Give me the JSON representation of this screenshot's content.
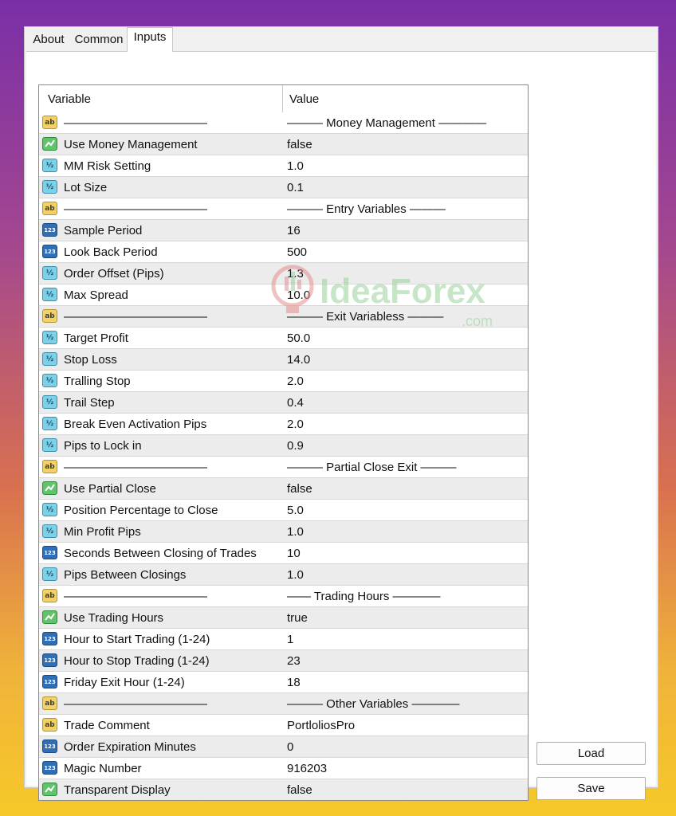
{
  "tabs": [
    "About",
    "Common",
    "Inputs"
  ],
  "active_tab": "Inputs",
  "table": {
    "headers": [
      "Variable",
      "Value"
    ],
    "rows": [
      {
        "type": "string",
        "icon": "string-ab-icon",
        "name": "————————————",
        "value": "——— Money Management ————"
      },
      {
        "type": "bool",
        "icon": "boolean-icon",
        "name": "Use Money Management",
        "value": "false"
      },
      {
        "type": "double",
        "icon": "double-icon",
        "name": "MM Risk Setting",
        "value": "1.0"
      },
      {
        "type": "double",
        "icon": "double-icon",
        "name": "Lot Size",
        "value": "0.1"
      },
      {
        "type": "string",
        "icon": "string-ab-icon",
        "name": "————————————",
        "value": "——— Entry Variables ———"
      },
      {
        "type": "int",
        "icon": "integer-icon",
        "name": "Sample Period",
        "value": "16"
      },
      {
        "type": "int",
        "icon": "integer-icon",
        "name": "Look Back Period",
        "value": "500"
      },
      {
        "type": "double",
        "icon": "double-icon",
        "name": "Order Offset (Pips)",
        "value": "1.3"
      },
      {
        "type": "double",
        "icon": "double-icon",
        "name": "Max Spread",
        "value": "10.0"
      },
      {
        "type": "string",
        "icon": "string-ab-icon",
        "name": "————————————",
        "value": "——— Exit Variabless ———"
      },
      {
        "type": "double",
        "icon": "double-icon",
        "name": "Target Profit",
        "value": "50.0"
      },
      {
        "type": "double",
        "icon": "double-icon",
        "name": "Stop Loss",
        "value": "14.0"
      },
      {
        "type": "double",
        "icon": "double-icon",
        "name": "Tralling Stop",
        "value": "2.0"
      },
      {
        "type": "double",
        "icon": "double-icon",
        "name": "Trail Step",
        "value": "0.4"
      },
      {
        "type": "double",
        "icon": "double-icon",
        "name": "Break Even Activation Pips",
        "value": "2.0"
      },
      {
        "type": "double",
        "icon": "double-icon",
        "name": "Pips to Lock in",
        "value": "0.9"
      },
      {
        "type": "string",
        "icon": "string-ab-icon",
        "name": "————————————",
        "value": "——— Partial Close Exit ———"
      },
      {
        "type": "bool",
        "icon": "boolean-icon",
        "name": "Use Partial Close",
        "value": "false"
      },
      {
        "type": "double",
        "icon": "double-icon",
        "name": "Position Percentage to Close",
        "value": "5.0"
      },
      {
        "type": "double",
        "icon": "double-icon",
        "name": "Min Profit Pips",
        "value": "1.0"
      },
      {
        "type": "int",
        "icon": "integer-icon",
        "name": "Seconds Between Closing of Trades",
        "value": "10"
      },
      {
        "type": "double",
        "icon": "double-icon",
        "name": "Pips Between Closings",
        "value": "1.0"
      },
      {
        "type": "string",
        "icon": "string-ab-icon",
        "name": "————————————",
        "value": "—— Trading Hours ————"
      },
      {
        "type": "bool",
        "icon": "boolean-icon",
        "name": "Use Trading Hours",
        "value": "true"
      },
      {
        "type": "int",
        "icon": "integer-icon",
        "name": "Hour to Start Trading (1-24)",
        "value": "1"
      },
      {
        "type": "int",
        "icon": "integer-icon",
        "name": "Hour to Stop Trading (1-24)",
        "value": "23"
      },
      {
        "type": "int",
        "icon": "integer-icon",
        "name": "Friday Exit Hour (1-24)",
        "value": "18"
      },
      {
        "type": "string",
        "icon": "string-ab-icon",
        "name": "————————————",
        "value": "——— Other Variables ————"
      },
      {
        "type": "string",
        "icon": "string-ab-icon",
        "name": "Trade Comment",
        "value": "PortloliosPro"
      },
      {
        "type": "int",
        "icon": "integer-icon",
        "name": "Order Expiration Minutes",
        "value": "0"
      },
      {
        "type": "int",
        "icon": "integer-icon",
        "name": "Magic Number",
        "value": "916203"
      },
      {
        "type": "bool",
        "icon": "boolean-icon",
        "name": "Transparent Display",
        "value": "false"
      }
    ]
  },
  "buttons": {
    "load": "Load",
    "save": "Save"
  },
  "watermark": {
    "text": "IdeaForex",
    "suffix": ".com"
  }
}
